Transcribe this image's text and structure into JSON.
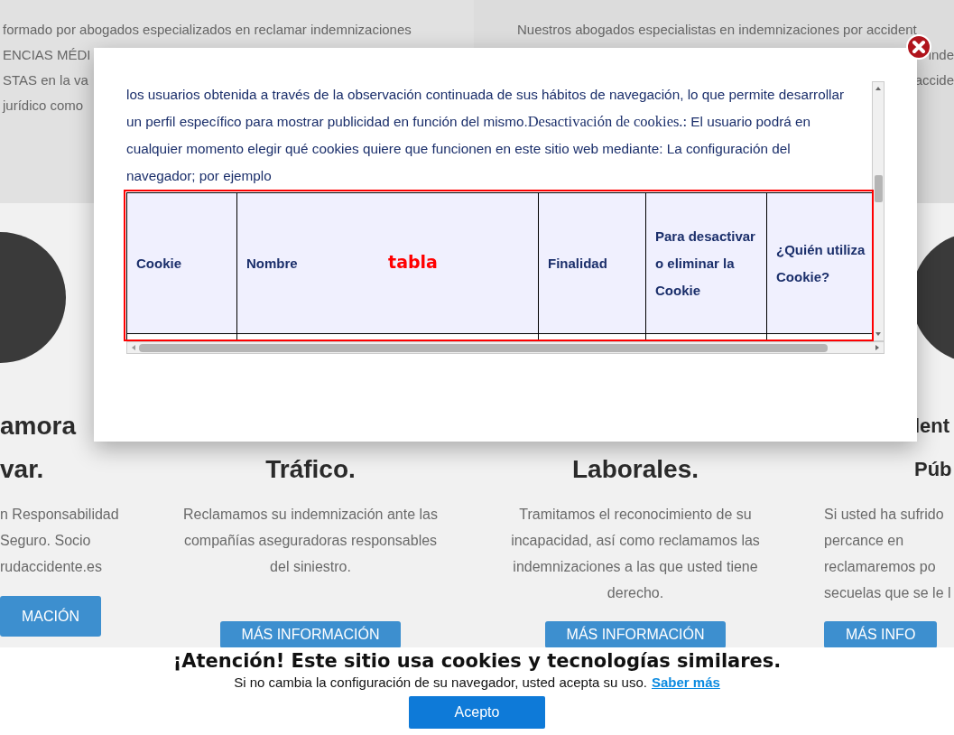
{
  "page": {
    "top_left_lines": [
      "formado por abogados especializados en reclamar indemnizaciones",
      "ENCIAS MÉDI",
      "STAS en la va",
      "jurídico como"
    ],
    "top_right_lines": [
      "Nuestros abogados especialistas en indemnizaciones por accident",
      "inde",
      "accide"
    ],
    "cards": [
      {
        "photo": true,
        "titles": [
          "amora",
          "var."
        ],
        "lines": [
          "n Responsabilidad",
          "Seguro. Socio",
          "rudaccidente.es"
        ],
        "button": "MACIÓN"
      },
      {
        "titles": [
          "Tráfico."
        ],
        "lines": [
          "Reclamamos su indemnización ante las",
          "compañías aseguradoras responsables",
          "del siniestro."
        ],
        "button": "MÁS INFORMACIÓN"
      },
      {
        "titles": [
          "Laborales."
        ],
        "lines": [
          "Tramitamos el reconocimiento de su",
          "incapacidad, así como reclamamos las",
          "indemnizaciones a las que usted tiene",
          "derecho."
        ],
        "button": "MÁS INFORMACIÓN"
      },
      {
        "photo": true,
        "titles": [
          "lent",
          "Púb"
        ],
        "lines": [
          "Si usted ha sufrido",
          "percance en",
          "reclamaremos po",
          "secuelas que se le l"
        ],
        "button": "MÁS INFO"
      }
    ]
  },
  "modal": {
    "text_before": "los usuarios obtenida a través de la observación continuada de sus hábitos de navegación, lo que permite desarrollar un perfil específico para mostrar publicidad en función del mismo.",
    "text_heading": "Desactivación de cookies.:",
    "text_after": " El usuario podrá en cualquier momento elegir qué cookies quiere que funcionen en este sitio web mediante: La configuración del navegador; por ejemplo",
    "table": {
      "columns": [
        "Cookie",
        "Nombre",
        "Finalidad",
        "Para desactivar o eliminar la Cookie",
        "¿Quién utiliza Cookie?"
      ],
      "annotation": "tabla"
    }
  },
  "banner": {
    "title": "¡Atención! Este sitio usa cookies y tecnologías similares.",
    "text": "Si no cambia la configuración de su navegador, usted acepta su uso.",
    "link": "Saber más",
    "button": "Acepto"
  }
}
